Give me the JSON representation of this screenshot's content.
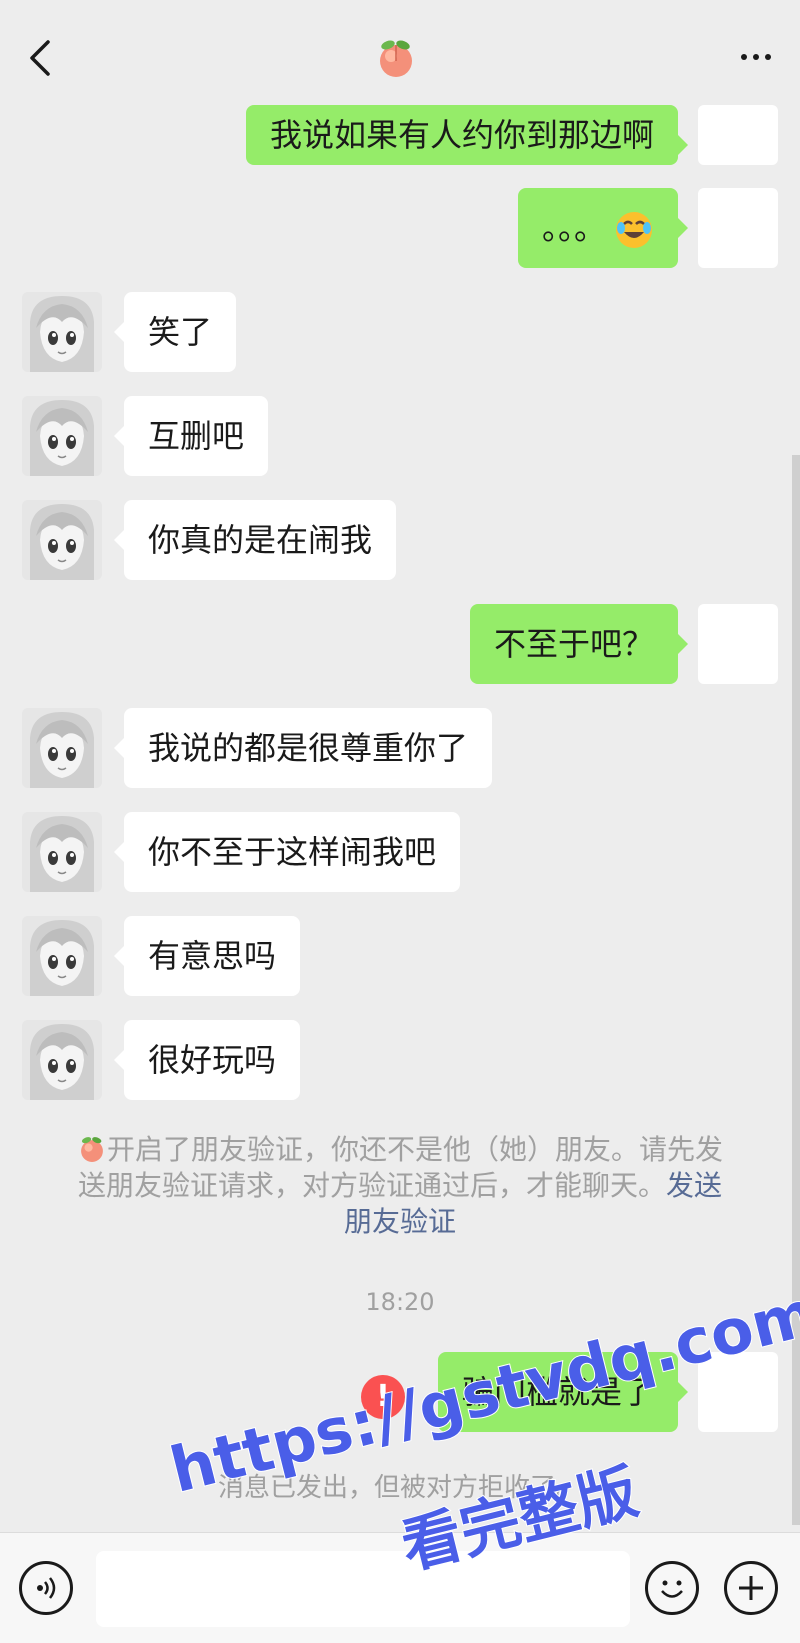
{
  "header": {
    "contact_name_icon": "peach-emoji-icon",
    "back_icon": "chevron-left-icon",
    "more_icon": "more-dots-icon"
  },
  "messages": [
    {
      "side": "right",
      "text": "我说如果有人约你到那边啊"
    },
    {
      "side": "right",
      "text": "。。。",
      "emoji": "laugh-cry-emoji"
    },
    {
      "side": "left",
      "text": "笑了"
    },
    {
      "side": "left",
      "text": "互删吧"
    },
    {
      "side": "left",
      "text": "你真的是在闹我"
    },
    {
      "side": "right",
      "text": "不至于吧？"
    },
    {
      "side": "left",
      "text": "我说的都是很尊重你了"
    },
    {
      "side": "left",
      "text": "你不至于这样闹我吧"
    },
    {
      "side": "left",
      "text": "有意思吗"
    },
    {
      "side": "left",
      "text": "很好玩吗"
    }
  ],
  "system_notice": {
    "text": "开启了朋友验证，你还不是他（她）朋友。请先发送朋友验证请求，对方验证通过后，才能聊天。",
    "link": "发送朋友验证"
  },
  "timestamp": "18:20",
  "last_message": {
    "side": "right",
    "text": "骗门槛就是了",
    "status": "failed"
  },
  "rejected_notice": "消息已发出，但被对方拒收了。",
  "input_bar": {
    "placeholder": "",
    "voice_icon": "voice-icon",
    "emoji_icon": "emoji-face-icon",
    "plus_icon": "plus-icon"
  },
  "watermark": {
    "url": "https://gstvdq.com",
    "caption": "看完整版"
  },
  "colors": {
    "background": "#ededed",
    "sent_bubble": "#95ec69",
    "received_bubble": "#ffffff",
    "link": "#576b95",
    "error": "#fa5151",
    "watermark": "#4a5ee8"
  }
}
